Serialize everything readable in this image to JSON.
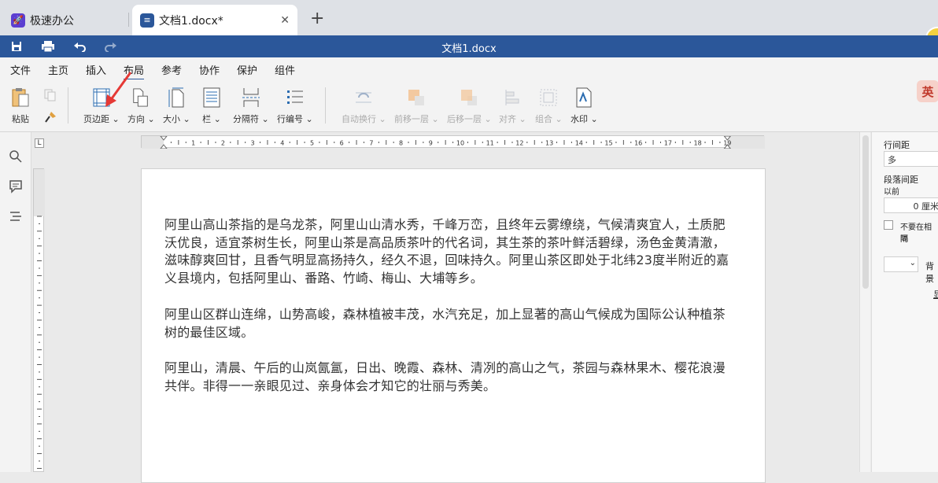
{
  "tabs": {
    "app_label": "极速办公",
    "doc_label": "文档1.docx*",
    "close": "✕",
    "new": "+"
  },
  "titlebar": {
    "title": "文档1.docx"
  },
  "menu": [
    "文件",
    "主页",
    "插入",
    "布局",
    "参考",
    "协作",
    "保护",
    "组件"
  ],
  "menu_active": "布局",
  "ribbon": {
    "paste": "粘贴",
    "margins": "页边距",
    "orientation": "方向",
    "size": "大小",
    "columns": "栏",
    "breaks": "分隔符",
    "line_numbers": "行编号",
    "wrap": "自动换行",
    "bring_forward": "前移一层",
    "send_backward": "后移一层",
    "align": "对齐",
    "group": "组合",
    "watermark": "水印",
    "dropdown": "⌄"
  },
  "ruler": {
    "corner": "L",
    "ticks": [
      "1",
      "2",
      "3",
      "4",
      "5",
      "6",
      "7",
      "8",
      "9",
      "10",
      "11",
      "12",
      "13",
      "14",
      "15",
      "16",
      "17",
      "18",
      "19"
    ]
  },
  "document": {
    "paragraphs": [
      "阿里山高山茶指的是乌龙茶，阿里山山清水秀，千峰万峦，且终年云雾缭绕，气候清爽宜人，土质肥沃优良，适宜茶树生长，阿里山茶是高品质茶叶的代名词，其生茶的茶叶鲜活碧绿，汤色金黄清澈，滋味醇爽回甘，且香气明显高扬持久，经久不退，回味持久。阿里山茶区即处于北纬23度半附近的嘉义县境内，包括阿里山、番路、竹崎、梅山、大埔等乡。",
      "阿里山区群山连绵，山势高峻，森林植被丰茂，水汽充足，加上显著的高山气候成为国际公认种植茶树的最佳区域。",
      "阿里山，清晨、午后的山岚氤氲，日出、晚霞、森林、清冽的高山之气，茶园与森林果木、樱花浪漫共伴。非得一一亲眼见过、亲身体会才知它的壮丽与秀美。"
    ]
  },
  "right_panel": {
    "line_spacing_label": "行间距",
    "line_spacing_value": "多",
    "para_spacing_label": "段落间距",
    "before_label": "以前",
    "before_value": "0 厘米",
    "no_space_label_1": "不要在相同",
    "no_space_label_2": "隔",
    "background_label": "背景",
    "show_more": "显"
  },
  "ime": "英",
  "colors": {
    "titlebar": "#2b579a",
    "tabbar": "#dee1e6",
    "arrow": "#e53935"
  }
}
